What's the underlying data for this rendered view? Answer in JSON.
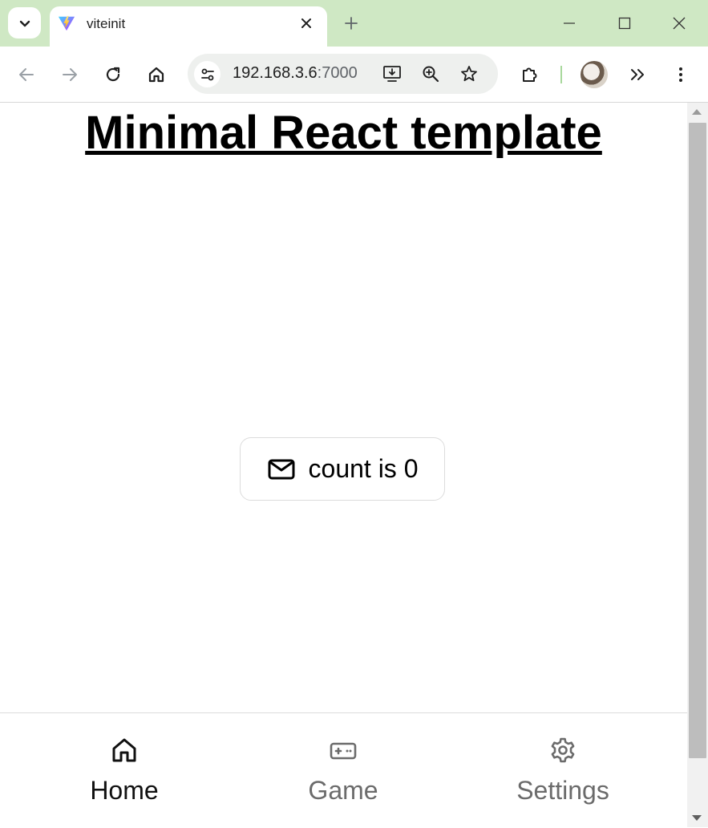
{
  "browser": {
    "tab": {
      "title": "viteinit",
      "favicon": "vite-logo-icon"
    },
    "omnibox": {
      "host": "192.168.3.6",
      "port": ":7000"
    },
    "colors": {
      "tabstrip": "#cfe8c4",
      "omnibox": "#eef0ee"
    }
  },
  "page": {
    "title": "Minimal React template",
    "counter_button": {
      "icon": "mail-icon",
      "label": "count is 0"
    }
  },
  "bottom_nav": {
    "items": [
      {
        "label": "Home",
        "icon": "home-icon",
        "active": true,
        "color": "#111111"
      },
      {
        "label": "Game",
        "icon": "gamepad-icon",
        "active": false,
        "color": "#6b6b6b"
      },
      {
        "label": "Settings",
        "icon": "settings-icon",
        "active": false,
        "color": "#6b6b6b"
      }
    ]
  }
}
